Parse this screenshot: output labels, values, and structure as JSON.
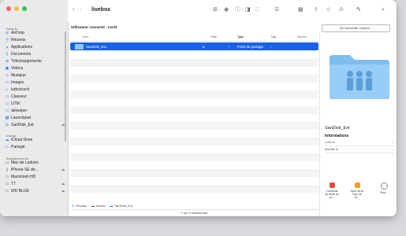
{
  "window": {
    "title": "livebox"
  },
  "colors": {
    "accent": "#1762e7",
    "folder": "#8ac6f5",
    "red": "#fe5f57",
    "yellow": "#febc2e",
    "green": "#28c840"
  },
  "sidebar": {
    "sections": {
      "favorites": "Favoris",
      "icloud": "iCloud",
      "locations": "Emplacements"
    },
    "favorites": [
      {
        "label": "AirDrop",
        "icon": "airdrop-icon"
      },
      {
        "label": "Récents",
        "icon": "clock-icon"
      },
      {
        "label": "Applications",
        "icon": "applications-icon"
      },
      {
        "label": "Documents",
        "icon": "document-icon"
      },
      {
        "label": "Téléchargements",
        "icon": "download-icon"
      },
      {
        "label": "Vidéos",
        "icon": "video-icon"
      },
      {
        "label": "Musique",
        "icon": "music-icon"
      },
      {
        "label": "Images",
        "icon": "images-icon"
      },
      {
        "label": "ludovicsch",
        "icon": "home-icon"
      },
      {
        "label": "Classeur",
        "icon": "folder-icon"
      },
      {
        "label": "UTM",
        "icon": "folder-icon"
      },
      {
        "label": "delvelper",
        "icon": "folder-icon"
      },
      {
        "label": "Launchpad",
        "icon": "launchpad-icon"
      },
      {
        "label": "SanDisk_Ext",
        "icon": "network-drive-icon"
      }
    ],
    "icloud": [
      {
        "label": "iCloud Drive",
        "icon": "cloud-icon"
      },
      {
        "label": "Partagé",
        "icon": "shared-folder-icon"
      }
    ],
    "locations": [
      {
        "label": "Mac de Ludovic",
        "icon": "laptop-icon"
      },
      {
        "label": "iPhone SE de...",
        "icon": "iphone-icon"
      },
      {
        "label": "Macintosh HD",
        "icon": "disk-icon"
      },
      {
        "label": "T7",
        "icon": "disk-icon"
      },
      {
        "label": "WD BLUE",
        "icon": "disk-icon"
      }
    ]
  },
  "banner": {
    "text": "Utilisateur connecté : invité",
    "connect_label": "Se connecter comme..."
  },
  "columns": {
    "name": "Nom",
    "size": "Taille",
    "type": "Type",
    "tags": "Tags",
    "version": "Version"
  },
  "selected_row": {
    "name": "SanDisk_Ext",
    "size": "--",
    "type": "Point de partage",
    "tags": "--"
  },
  "pathbar": {
    "network": "Réseau",
    "host": "livebox",
    "share": "SanDisk_Ext"
  },
  "status": {
    "text": "1 sur 1 sélectionné"
  },
  "preview": {
    "name": "SanDisk_Ext",
    "info_title": "Informations",
    "created_label": "Créé le",
    "created_value": "--",
    "modified_label": "Modifié le",
    "modified_value": "--",
    "actions": [
      {
        "label": "Connecté du texte en un...",
        "icon": "connect-icon"
      },
      {
        "label": "Quel est le nom de l'ê...",
        "icon": "name-icon"
      },
      {
        "label": "Plus...",
        "icon": "more-icon"
      }
    ]
  }
}
